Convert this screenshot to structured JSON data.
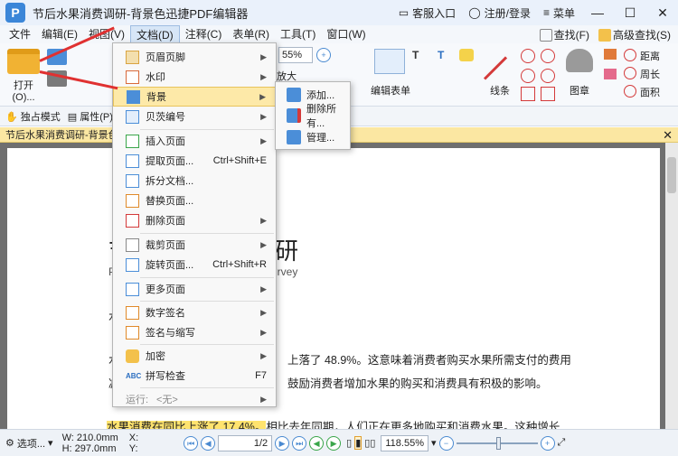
{
  "window": {
    "title": "节后水果消费调研-背景色迅捷PDF编辑器",
    "logo": "P",
    "service": "客服入口",
    "login": "注册/登录",
    "menu": "菜单"
  },
  "menubar": {
    "items": [
      "文件",
      "编辑(E)",
      "视图(V)",
      "文档(D)",
      "注释(C)",
      "表单(R)",
      "工具(T)",
      "窗口(W)"
    ],
    "find": "查找(F)",
    "advanced_find": "高级查找(S)"
  },
  "ribbon": {
    "open_label": "打开(O)...",
    "zoom_value": "55%",
    "enlarge_label": "放大",
    "edit_form_label": "编辑表单",
    "line_label": "线条",
    "stamp_label": "图章",
    "distance_label": "距离",
    "perimeter_label": "周长",
    "area_label": "面积"
  },
  "subtoolbar": {
    "exclusive_mode": "独占模式",
    "properties": "属性(P)..."
  },
  "doc_tab": {
    "title": "节后水果消费调研-背景色"
  },
  "document": {
    "heading_fragment": "研",
    "heading_left": "节",
    "sub_fragment": "urvey",
    "sub_left": "P",
    "para_left1": "水",
    "line1_left": "水",
    "line1": "上落了 48.9%。这意味着消费者购买水果所需支付的费用",
    "line2_left": "减",
    "line2": "鼓励消费者增加水果的购买和消费具有积极的影响。",
    "line3_highlight": "水果消费在同比上涨了 17.4%。",
    "line3_rest": "相比去年同期，人们正在更多地购买和消费水果。这种增长"
  },
  "dropdown": {
    "items": [
      {
        "label": "页眉页脚",
        "shortcut": "",
        "submenu": true
      },
      {
        "label": "水印",
        "shortcut": "",
        "submenu": true
      },
      {
        "label": "背景",
        "shortcut": "",
        "submenu": true
      },
      {
        "label": "贝茨编号",
        "shortcut": "",
        "submenu": true
      },
      {
        "label": "插入页面",
        "shortcut": "",
        "submenu": true
      },
      {
        "label": "提取页面...",
        "shortcut": "Ctrl+Shift+E",
        "submenu": false
      },
      {
        "label": "拆分文档...",
        "shortcut": "",
        "submenu": false
      },
      {
        "label": "替换页面...",
        "shortcut": "",
        "submenu": false
      },
      {
        "label": "删除页面",
        "shortcut": "",
        "submenu": true
      },
      {
        "label": "裁剪页面",
        "shortcut": "",
        "submenu": true
      },
      {
        "label": "旋转页面...",
        "shortcut": "Ctrl+Shift+R",
        "submenu": false
      },
      {
        "label": "更多页面",
        "shortcut": "",
        "submenu": true
      },
      {
        "label": "数字签名",
        "shortcut": "",
        "submenu": true
      },
      {
        "label": "签名与缩写",
        "shortcut": "",
        "submenu": true
      },
      {
        "label": "加密",
        "shortcut": "",
        "submenu": true
      },
      {
        "label": "拼写检查",
        "shortcut": "F7",
        "submenu": false
      }
    ],
    "run_label": "运行:",
    "run_value": "<无>"
  },
  "submenu": {
    "items": [
      "添加...",
      "删除所有...",
      "管理..."
    ]
  },
  "statusbar": {
    "options": "选项...",
    "width": "W: 210.0mm",
    "height": "H: 297.0mm",
    "x_label": "X:",
    "y_label": "Y:",
    "page_value": "1",
    "page_total": "/2",
    "zoom": "118.55%"
  },
  "colors": {
    "highlight": "#ffe36e",
    "menu_hover": "#fde9a8",
    "annotation_arrow": "#e03131",
    "doc_tab": "#fbe7a2"
  }
}
